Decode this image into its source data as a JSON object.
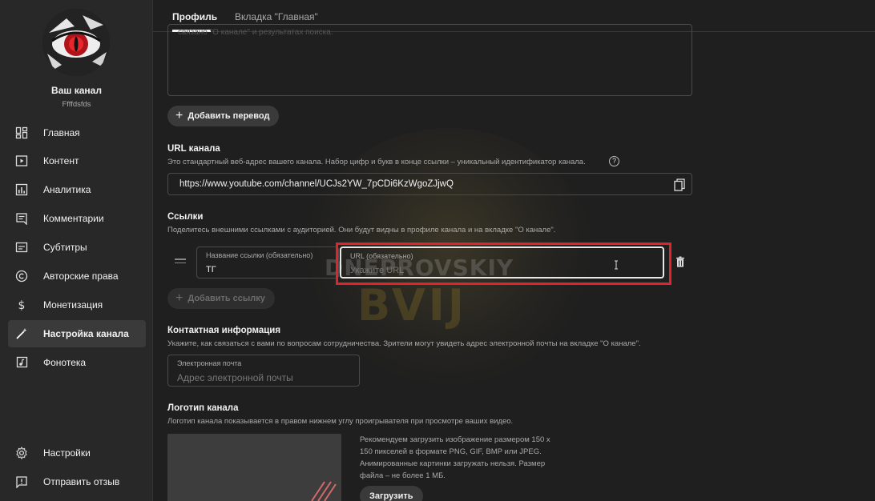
{
  "channel": {
    "name": "Ваш канал",
    "handle": "Ffffdsfds"
  },
  "sidebar": {
    "items": [
      {
        "label": "Главная",
        "icon": "dashboard-icon"
      },
      {
        "label": "Контент",
        "icon": "content-icon"
      },
      {
        "label": "Аналитика",
        "icon": "analytics-icon"
      },
      {
        "label": "Комментарии",
        "icon": "comments-icon"
      },
      {
        "label": "Субтитры",
        "icon": "subtitles-icon"
      },
      {
        "label": "Авторские права",
        "icon": "copyright-icon"
      },
      {
        "label": "Монетизация",
        "icon": "dollar-icon"
      },
      {
        "label": "Настройка канала",
        "icon": "magic-wand-icon",
        "active": true
      },
      {
        "label": "Фонотека",
        "icon": "audio-library-icon"
      }
    ],
    "bottom": [
      {
        "label": "Настройки",
        "icon": "gear-icon"
      },
      {
        "label": "Отправить отзыв",
        "icon": "feedback-icon"
      }
    ]
  },
  "tabs": [
    {
      "label": "Профиль",
      "active": true
    },
    {
      "label": "Вкладка \"Главная\"",
      "active": false
    }
  ],
  "description_box": {
    "text": "связано \"О канале\" и результатах поиска."
  },
  "add_translation_label": "Добавить перевод",
  "url_section": {
    "title": "URL канала",
    "description": "Это стандартный веб-адрес вашего канала. Набор цифр и букв в конце ссылки – уникальный идентификатор канала.",
    "url": "https://www.youtube.com/channel/UCJs2YW_7pCDi6KzWgoZJjwQ"
  },
  "links_section": {
    "title": "Ссылки",
    "description": "Поделитесь внешними ссылками с аудиторией. Они будут видны в профиле канала и на вкладке \"О канале\".",
    "link_title_label": "Название ссылки (обязательно)",
    "link_title_value": "ТГ",
    "link_url_label": "URL (обязательно)",
    "link_url_placeholder": "Укажите URL",
    "add_link_label": "Добавить ссылку"
  },
  "contact_section": {
    "title": "Контактная информация",
    "description": "Укажите, как связаться с вами по вопросам сотрудничества. Зрители могут увидеть адрес электронной почты на вкладке \"О канале\".",
    "email_label": "Электронная почта",
    "email_placeholder": "Адрес электронной почты"
  },
  "logo_section": {
    "title": "Логотип канала",
    "description": "Логотип канала показывается в правом нижнем углу проигрывателя при просмотре ваших видео.",
    "recommendation": "Рекомендуем загрузить изображение размером 150 х 150 пикселей в формате PNG, GIF, BMP или JPEG. Анимированные картинки загружать нельзя. Размер файла – не более 1 МБ.",
    "upload_label": "Загрузить"
  },
  "watermark": {
    "line1": "DNEPROVSKIY",
    "line2": "BVIJ"
  },
  "colors": {
    "highlight": "#e0242b",
    "background": "#1f1f1f",
    "sidebar": "#282828"
  }
}
